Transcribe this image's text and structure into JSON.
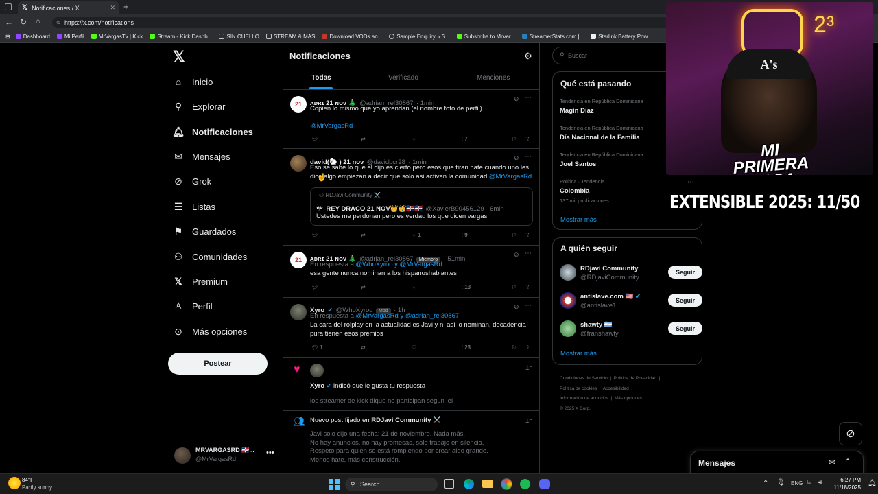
{
  "browser": {
    "tab_title": "Notificaciones / X",
    "url": "https://x.com/notifications",
    "bookmarks": [
      "Dashboard",
      "Mi Perfil",
      "MrVargasTv | Kick",
      "Stream - Kick Dashb...",
      "SIN CUELLO",
      "STREAM & MAS",
      "Download VODs an...",
      "Sample Enquiry » S...",
      "Subscribe to MrVar...",
      "StreamerStats.com |...",
      "Starlink Battery Pow..."
    ]
  },
  "nav": {
    "items": [
      "Inicio",
      "Explorar",
      "Notificaciones",
      "Mensajes",
      "Grok",
      "Listas",
      "Guardados",
      "Comunidades",
      "Premium",
      "Perfil",
      "Más opciones"
    ],
    "post_button": "Postear",
    "account_name": "MRVARGASRD 🇩🇴...",
    "account_handle": "@MrVargasRd"
  },
  "header": {
    "title": "Notificaciones",
    "tabs": [
      "Todas",
      "Verificado",
      "Menciones"
    ]
  },
  "posts": [
    {
      "name": "ᴀᴅʀɪ 21 ɴᴏᴠ 🎄",
      "handle": "@adrian_rel30867",
      "time": "· 1min",
      "text": "Copien lo mismo que yo aprendan (el nombre foto de perfil)",
      "mention": "@MrVargasRd",
      "views": "7"
    },
    {
      "name": "david(🐑 ) 21 nov",
      "handle": "@davidbcr28",
      "time": "· 1min",
      "text1": "Eso se sabe lo que el dijo es cierto pero esos que tiran hate cuando uno les",
      "text2": "dice algo empiezan a decir que solo asi activan la comunidad",
      "mention": "@MrVargasRd",
      "quote_community": "RDJavi Community ⚔️",
      "quote_name": "REY DRACO 21 NOV👑👑🇩🇴🇩🇴",
      "quote_handle": "@XavierB90456129 · 6min",
      "quote_text": "Ustedes me perdonan pero es verdad los que dicen vargas",
      "likes": "1",
      "views": "9"
    },
    {
      "name": "ᴀᴅʀɪ 21 ɴᴏᴠ 🎄",
      "handle": "@adrian_rel30867",
      "badge": "Miembro",
      "time": "· 51min",
      "reply_prefix": "En respuesta a",
      "reply_users": "@WhoXyroo y @MrVargasRd",
      "text": "esa gente nunca nominan a los hispanoshablantes",
      "views": "13"
    },
    {
      "name": "Xyro",
      "handle": "@WhoXyroo",
      "badge": "Mod",
      "time": "· 1h",
      "reply_prefix": "En respuesta a",
      "reply_users": "@MrVargasRd y @adrian_rel30867",
      "text1": "La cara del rolplay en la actualidad es Javi y ni así lo nominan, decadencia",
      "text2": "pura tienen esos premios",
      "replies": "1",
      "views": "23"
    },
    {
      "name": "Xyro",
      "action": "indicó que le gusta tu respuesta",
      "time": "1h",
      "text": "los streamer de kick dique no participan segun lei"
    },
    {
      "prefix": "Nuevo post fijado en",
      "community": "RDJavi Community ⚔️",
      "time": "1h",
      "lines": [
        "Javi solo dijo una fecha: 21 de noviembre. Nada más.",
        "No hay anuncios, no hay promesas, solo trabajo en silencio.",
        "Respeto para quien se está rompiendo por crear algo grande.",
        "Menos hate, más construcción."
      ]
    }
  ],
  "sidebar": {
    "search_placeholder": "Buscar",
    "trends_title": "Qué está pasando",
    "trends": [
      {
        "context": "Tendencia en República Dominicana",
        "name": "Magín Díaz"
      },
      {
        "context": "Tendencia en República Dominicana",
        "name": "Día Nacional de la Familia"
      },
      {
        "context": "Tendencia en República Dominicana",
        "name": "Joel Santos"
      },
      {
        "context": "Política · Tendencia",
        "name": "Colombia",
        "count": "137 mil publicaciones"
      }
    ],
    "show_more": "Mostrar más",
    "follow_title": "A quién seguir",
    "follow": [
      {
        "name": "RDjavi Community",
        "handle": "@RDjaviCommunity"
      },
      {
        "name": "antislave.com 🇺🇸",
        "handle": "@antislave1"
      },
      {
        "name": "shawty 🇦🇷",
        "handle": "@franshawty"
      }
    ],
    "follow_button": "Seguir",
    "footer": [
      "Condiciones de Servicio",
      "Política de Privacidad",
      "Política de cookies",
      "Accesibilidad",
      "Información de anuncios",
      "Más opciones ...",
      "© 2025 X Corp."
    ]
  },
  "overlay": {
    "cam_text": "MI PRIMERA CASA",
    "banner": "EXTENSIBLE 2025: 11/50"
  },
  "messages_drawer": {
    "title": "Mensajes"
  },
  "taskbar": {
    "temp": "84°F",
    "weather": "Partly sunny",
    "search": "Search",
    "lang": "ENG",
    "time": "6:27 PM",
    "date": "11/18/2025"
  },
  "colors": {
    "accent": "#1d9bf0",
    "like": "#f91880",
    "border": "#2f3336"
  }
}
